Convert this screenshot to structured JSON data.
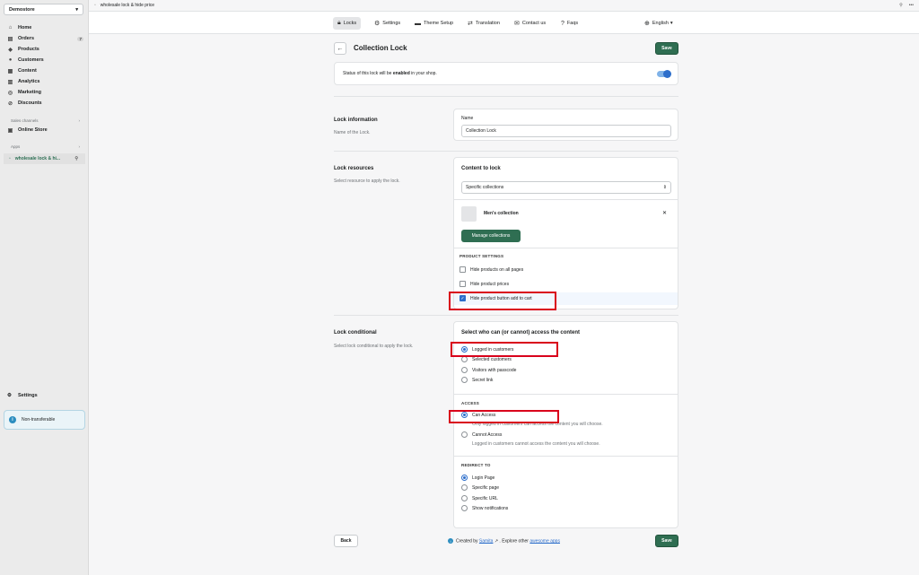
{
  "sidebar": {
    "store": "Demostore",
    "nav": [
      {
        "icon": "home-icon",
        "glyph": "⌂",
        "label": "Home"
      },
      {
        "icon": "orders-icon",
        "glyph": "▤",
        "label": "Orders",
        "badge": "7"
      },
      {
        "icon": "products-icon",
        "glyph": "◆",
        "label": "Products"
      },
      {
        "icon": "customers-icon",
        "glyph": "●",
        "label": "Customers"
      },
      {
        "icon": "content-icon",
        "glyph": "▦",
        "label": "Content"
      },
      {
        "icon": "analytics-icon",
        "glyph": "▥",
        "label": "Analytics"
      },
      {
        "icon": "marketing-icon",
        "glyph": "◎",
        "label": "Marketing"
      },
      {
        "icon": "discounts-icon",
        "glyph": "⊘",
        "label": "Discounts"
      }
    ],
    "sales_channels_label": "Sales channels",
    "online_store": "Online Store",
    "apps_label": "Apps",
    "app_item": "wholesale lock & hi...",
    "settings": "Settings",
    "non_transferable": "Non-transferable"
  },
  "topbar": {
    "title": "wholesale lock & hide price"
  },
  "appnav": {
    "tabs": [
      "Locks",
      "Settings",
      "Theme Setup",
      "Translation",
      "Contact us",
      "Faqs"
    ],
    "language": "English"
  },
  "page": {
    "title": "Collection Lock",
    "save": "Save",
    "status_pre": "Status of this lock will be ",
    "status_bold": "enabled",
    "status_post": " in your shop."
  },
  "lock_info": {
    "title": "Lock information",
    "desc": "Name of the Lock.",
    "name_label": "Name",
    "name_value": "Collection Lock"
  },
  "lock_resources": {
    "title": "Lock resources",
    "desc": "Select resource to apply the lock.",
    "content_label": "Content to lock",
    "selected": "Specific collections",
    "collection": "Men's collection",
    "manage": "Manage collections",
    "product_settings": "PRODUCT SETTINGS",
    "options": [
      {
        "label": "Hide products on all pages",
        "checked": false
      },
      {
        "label": "Hide product prices",
        "checked": false
      },
      {
        "label": "Hide product button add to cart",
        "checked": true
      }
    ]
  },
  "lock_conditional": {
    "title": "Lock conditional",
    "desc": "Select lock conditional to apply the lock.",
    "who_label": "Select who can (or cannot) access the content",
    "who_options": [
      "Logged in customers",
      "Selected customers",
      "Visitors with passcode",
      "Secret link"
    ],
    "who_selected": 0,
    "access_label": "ACCESS",
    "access_options": [
      {
        "label": "Can Access",
        "help": "Only logged in customers can access the content you will choose."
      },
      {
        "label": "Cannot Access",
        "help": "Logged in customers cannot access the content you will choose."
      }
    ],
    "access_selected": 0,
    "redirect_label": "REDIRECT TO",
    "redirect_options": [
      "Login Page",
      "Specific page",
      "Specific URL",
      "Show notifications"
    ],
    "redirect_selected": 0
  },
  "bottom": {
    "back": "Back",
    "save": "Save"
  },
  "footer": {
    "pre": "Created by ",
    "author": "Samita",
    "mid": " . Explore other ",
    "link": "awesome apps"
  },
  "colors": {
    "primary": "#2f6e52",
    "accent": "#2c6ecb",
    "highlight": "#d9001b"
  }
}
